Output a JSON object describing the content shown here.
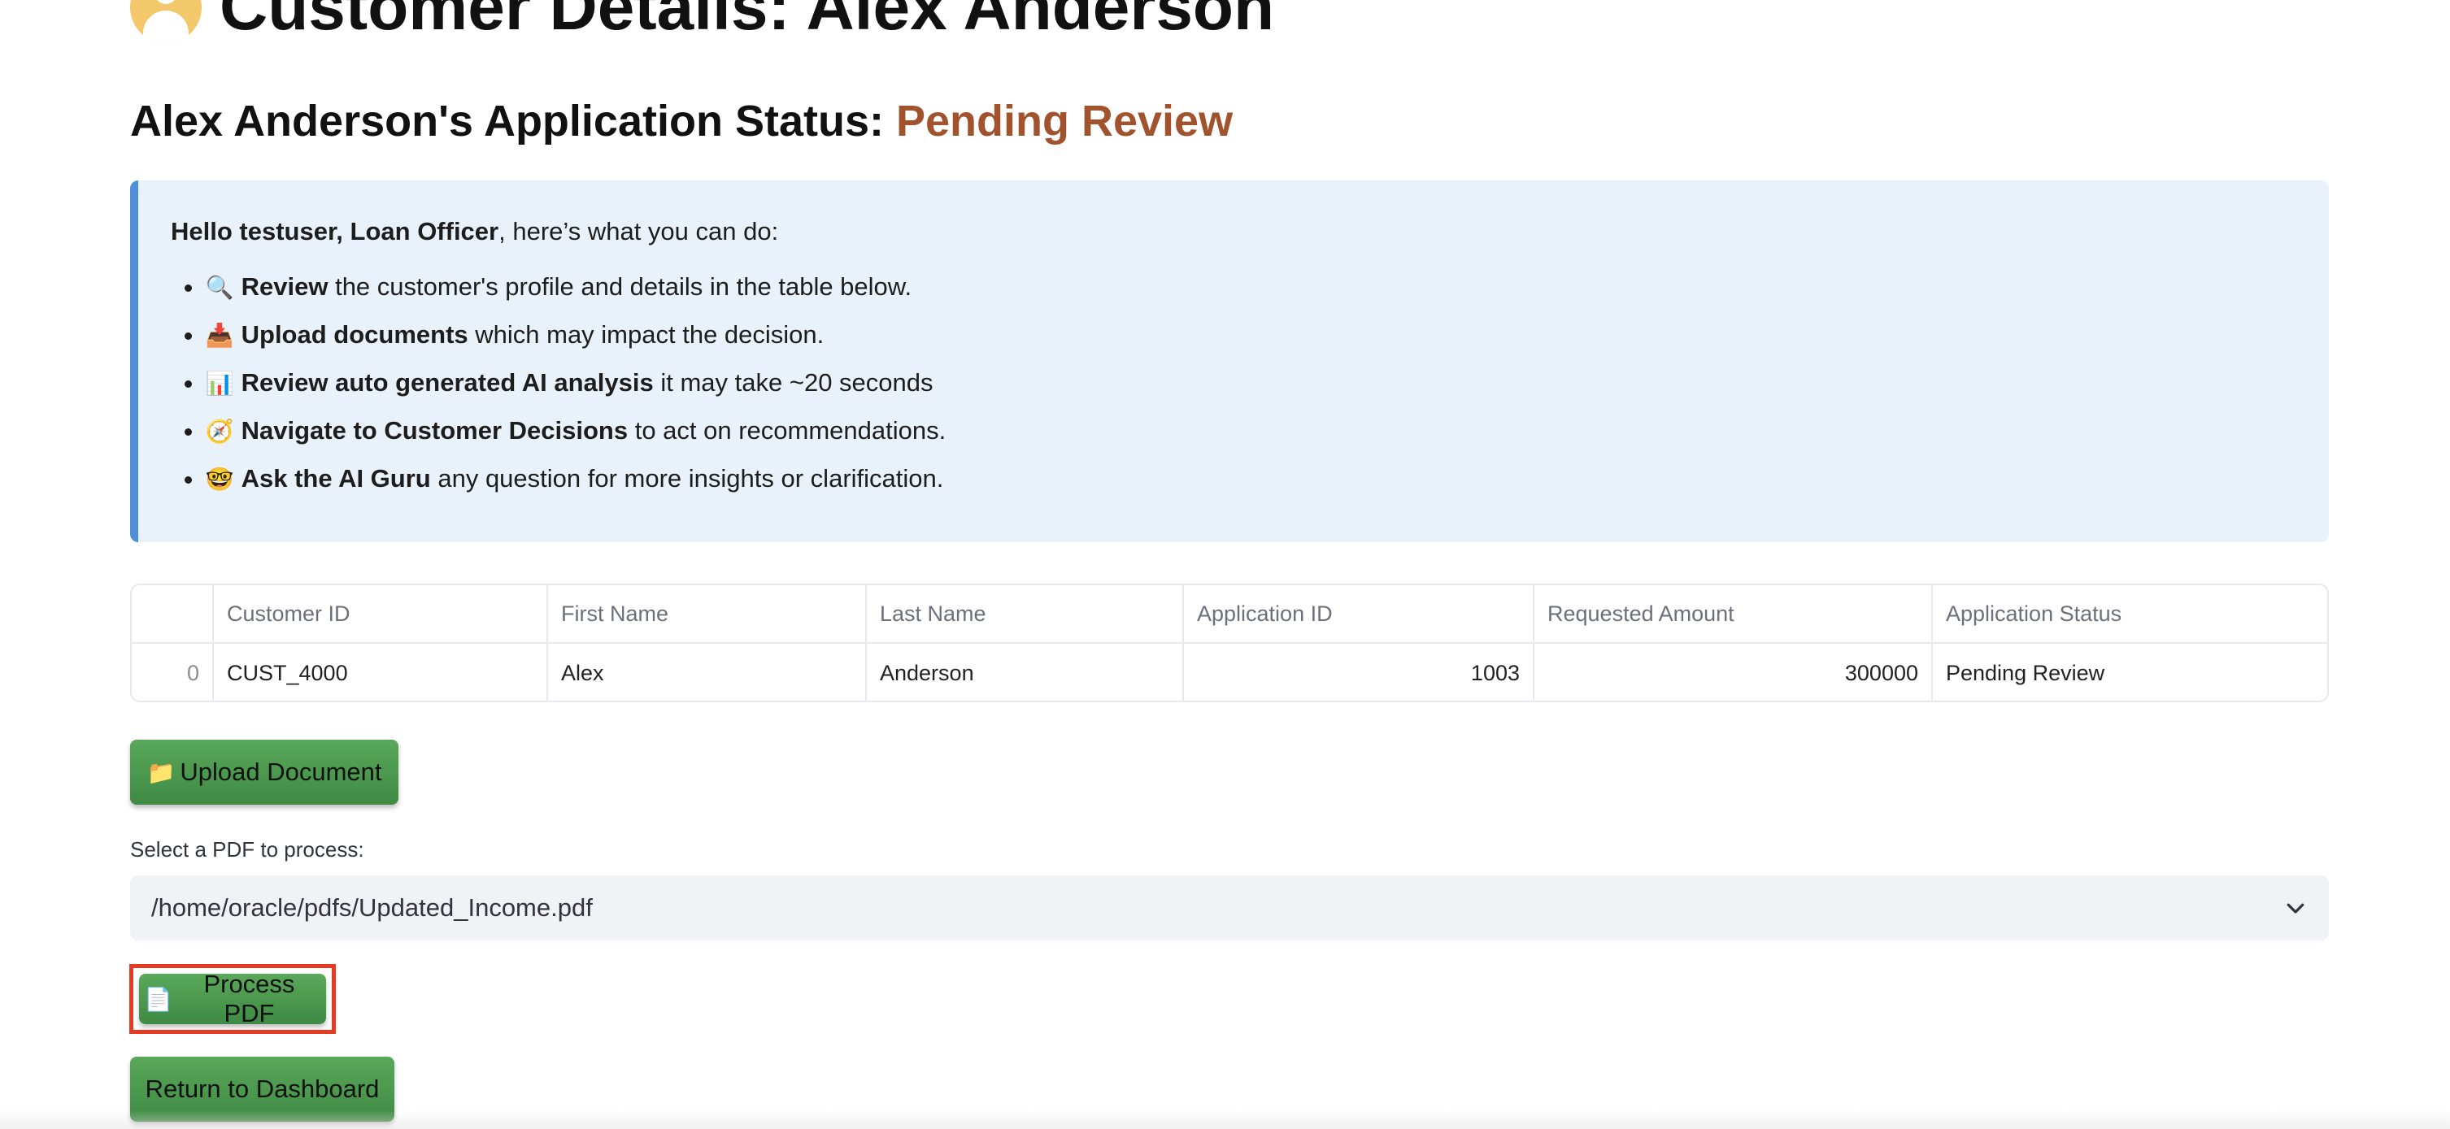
{
  "header": {
    "title": "Customer Details: Alex Anderson",
    "icon": "user-avatar-icon"
  },
  "status": {
    "prefix": "Alex Anderson's Application Status: ",
    "value": "Pending Review",
    "value_color": "#a0532c"
  },
  "info": {
    "greeting_bold": "Hello testuser, Loan Officer",
    "greeting_rest": ", here’s what you can do:",
    "items": [
      {
        "icon": "magnifier-icon",
        "glyph": "🔍",
        "bold": "Review",
        "rest": " the customer's profile and details in the table below."
      },
      {
        "icon": "inbox-tray-icon",
        "glyph": "📥",
        "bold": "Upload documents",
        "rest": " which may impact the decision."
      },
      {
        "icon": "bar-chart-icon",
        "glyph": "📊",
        "bold": "Review auto generated AI analysis",
        "rest": " it may take ~20 seconds"
      },
      {
        "icon": "compass-icon",
        "glyph": "🧭",
        "bold": "Navigate to Customer Decisions",
        "rest": " to act on recommendations."
      },
      {
        "icon": "nerd-face-icon",
        "glyph": "🤓",
        "bold": "Ask the AI Guru",
        "rest": " any question for more insights or clarification."
      }
    ]
  },
  "table": {
    "columns": [
      "",
      "Customer ID",
      "First Name",
      "Last Name",
      "Application ID",
      "Requested Amount",
      "Application Status"
    ],
    "rows": [
      [
        "0",
        "CUST_4000",
        "Alex",
        "Anderson",
        "1003",
        "300000",
        "Pending Review"
      ]
    ]
  },
  "buttons": {
    "upload_icon": "folder-icon",
    "upload_glyph": "📁",
    "upload_label": "Upload Document",
    "process_icon": "page-icon",
    "process_glyph": "📄",
    "process_label": "Process PDF",
    "return_label": "Return to Dashboard"
  },
  "pdf_select": {
    "label": "Select a PDF to process:",
    "value": "/home/oracle/pdfs/Updated_Income.pdf"
  },
  "colors": {
    "button_green": "#4e9c4e",
    "info_bg": "#e9f1fa",
    "info_border": "#4f90d8",
    "highlight_border": "#e53b25"
  }
}
